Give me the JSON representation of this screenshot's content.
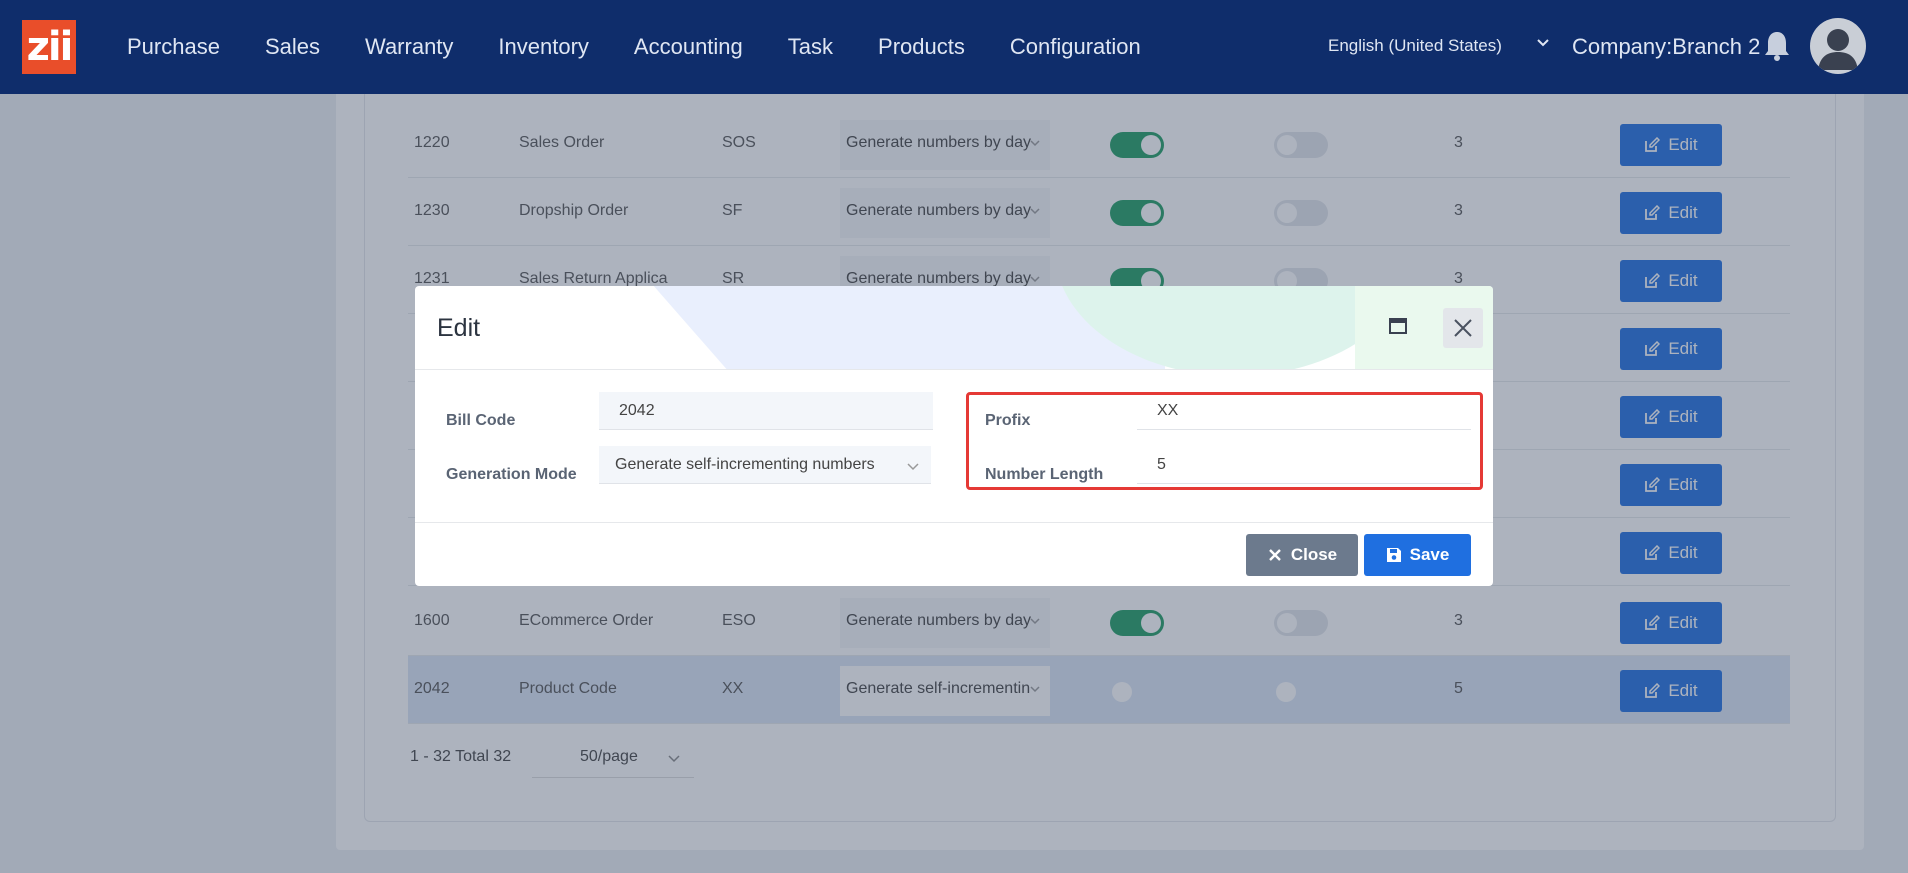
{
  "nav": {
    "logo_text": "zii",
    "items": [
      "Purchase",
      "Sales",
      "Warranty",
      "Inventory",
      "Accounting",
      "Task",
      "Products",
      "Configuration"
    ],
    "language": "English (United States)",
    "company": "Company:Branch 2"
  },
  "table": {
    "edit_label": "Edit",
    "rows": [
      {
        "code": "1220",
        "name": "Sales Order",
        "prefix": "SOS",
        "mode": "Generate numbers by day",
        "t1": "on",
        "t2": "off",
        "length": "3"
      },
      {
        "code": "1230",
        "name": "Dropship Order",
        "prefix": "SF",
        "mode": "Generate numbers by day",
        "t1": "on",
        "t2": "off",
        "length": "3"
      },
      {
        "code": "1231",
        "name": "Sales Return Applica",
        "prefix": "SR",
        "mode": "Generate numbers by day",
        "t1": "on",
        "t2": "off",
        "length": "3"
      },
      {
        "code": "1600",
        "name": "ECommerce Order",
        "prefix": "ESO",
        "mode": "Generate numbers by day",
        "t1": "on",
        "t2": "off",
        "length": "3"
      },
      {
        "code": "2042",
        "name": "Product Code",
        "prefix": "XX",
        "mode": "Generate self-incrementin",
        "t1": "none",
        "t2": "none",
        "length": "5"
      }
    ]
  },
  "pager": {
    "summary": "1 - 32 Total 32",
    "page_size": "50/page"
  },
  "modal": {
    "title": "Edit",
    "bill_code_label": "Bill Code",
    "bill_code_value": "2042",
    "generation_mode_label": "Generation Mode",
    "generation_mode_value": "Generate self-incrementing numbers",
    "prefix_label": "Profix",
    "prefix_value": "XX",
    "number_length_label": "Number Length",
    "number_length_value": "5",
    "close_label": "Close",
    "save_label": "Save"
  },
  "colors": {
    "nav_bg": "#0f2d6b",
    "primary": "#1f6fe0",
    "toggle_on": "#1f9d63",
    "highlight_box": "#e53935"
  }
}
